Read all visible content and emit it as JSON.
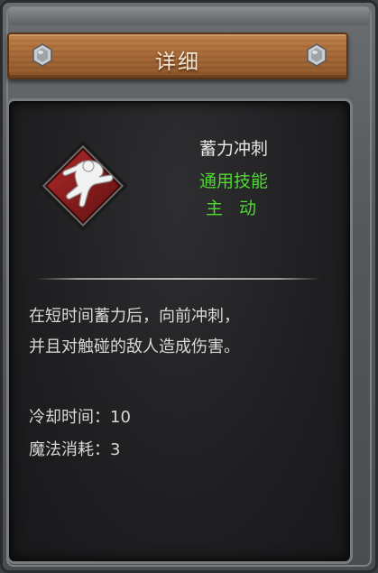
{
  "header": {
    "title": "详细"
  },
  "skill": {
    "icon": "dash-runner-icon",
    "name": "蓄力冲刺",
    "type": "通用技能",
    "mode": "主 动",
    "description_line1": "在短时间蓄力后，向前冲刺，",
    "description_line2": "并且对触碰的敌人造成伤害。",
    "cooldown": "冷却时间：10",
    "mana_cost": "魔法消耗：3"
  },
  "colors": {
    "type_text": "#4fd832",
    "plank": "#a86a38",
    "icon_tile": "#8a1c1c"
  }
}
